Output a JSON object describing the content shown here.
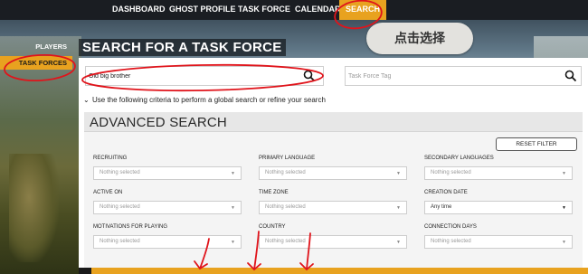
{
  "topnav": {
    "items": [
      {
        "label": "DASHBOARD",
        "active": false
      },
      {
        "label": "GHOST PROFILE",
        "active": false
      },
      {
        "label": "TASK FORCE",
        "active": false
      },
      {
        "label": "CALENDAR",
        "active": false
      },
      {
        "label": "SEARCH",
        "active": true
      }
    ]
  },
  "sidebar": {
    "items": [
      {
        "label": "PLAYERS",
        "active": false
      },
      {
        "label": "TASK FORCES",
        "active": true
      }
    ]
  },
  "page": {
    "title": "SEARCH FOR A TASK FORCE"
  },
  "hint": {
    "text": "点击选择"
  },
  "search": {
    "name_value": "Old big brother",
    "name_placeholder": "",
    "tag_placeholder": "Task Force Tag"
  },
  "criteria": {
    "text": "Use the following criteria to perform a global search or refine your search"
  },
  "advanced": {
    "title": "ADVANCED SEARCH",
    "reset_label": "RESET FILTER",
    "fields": [
      {
        "label": "RECRUITING",
        "value": "Nothing selected"
      },
      {
        "label": "PRIMARY LANGUAGE",
        "value": "Nothing selected"
      },
      {
        "label": "SECONDARY LANGUAGES",
        "value": "Nothing selected"
      },
      {
        "label": "ACTIVE ON",
        "value": "Nothing selected"
      },
      {
        "label": "TIME ZONE",
        "value": "Nothing selected"
      },
      {
        "label": "CREATION DATE",
        "value": "Any time"
      },
      {
        "label": "MOTIVATIONS FOR PLAYING",
        "value": "Nothing selected"
      },
      {
        "label": "COUNTRY",
        "value": "Nothing selected"
      },
      {
        "label": "CONNECTION DAYS",
        "value": "Nothing selected"
      }
    ]
  },
  "colors": {
    "accent": "#e8a21f",
    "annotation": "#e0141b",
    "nav_bg": "#1a1d22"
  }
}
